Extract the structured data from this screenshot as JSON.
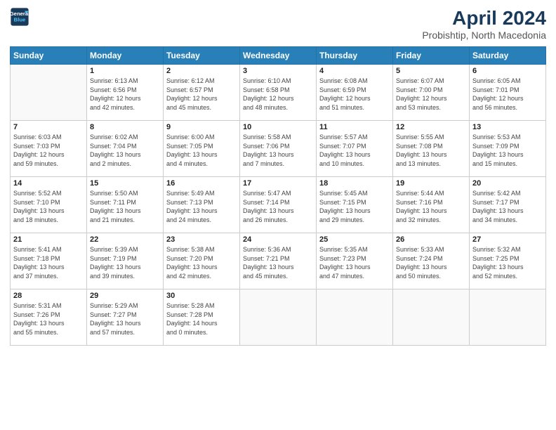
{
  "header": {
    "logo_line1": "General",
    "logo_line2": "Blue",
    "title": "April 2024",
    "subtitle": "Probishtip, North Macedonia"
  },
  "weekdays": [
    "Sunday",
    "Monday",
    "Tuesday",
    "Wednesday",
    "Thursday",
    "Friday",
    "Saturday"
  ],
  "weeks": [
    [
      {
        "day": "",
        "info": ""
      },
      {
        "day": "1",
        "info": "Sunrise: 6:13 AM\nSunset: 6:56 PM\nDaylight: 12 hours\nand 42 minutes."
      },
      {
        "day": "2",
        "info": "Sunrise: 6:12 AM\nSunset: 6:57 PM\nDaylight: 12 hours\nand 45 minutes."
      },
      {
        "day": "3",
        "info": "Sunrise: 6:10 AM\nSunset: 6:58 PM\nDaylight: 12 hours\nand 48 minutes."
      },
      {
        "day": "4",
        "info": "Sunrise: 6:08 AM\nSunset: 6:59 PM\nDaylight: 12 hours\nand 51 minutes."
      },
      {
        "day": "5",
        "info": "Sunrise: 6:07 AM\nSunset: 7:00 PM\nDaylight: 12 hours\nand 53 minutes."
      },
      {
        "day": "6",
        "info": "Sunrise: 6:05 AM\nSunset: 7:01 PM\nDaylight: 12 hours\nand 56 minutes."
      }
    ],
    [
      {
        "day": "7",
        "info": "Sunrise: 6:03 AM\nSunset: 7:03 PM\nDaylight: 12 hours\nand 59 minutes."
      },
      {
        "day": "8",
        "info": "Sunrise: 6:02 AM\nSunset: 7:04 PM\nDaylight: 13 hours\nand 2 minutes."
      },
      {
        "day": "9",
        "info": "Sunrise: 6:00 AM\nSunset: 7:05 PM\nDaylight: 13 hours\nand 4 minutes."
      },
      {
        "day": "10",
        "info": "Sunrise: 5:58 AM\nSunset: 7:06 PM\nDaylight: 13 hours\nand 7 minutes."
      },
      {
        "day": "11",
        "info": "Sunrise: 5:57 AM\nSunset: 7:07 PM\nDaylight: 13 hours\nand 10 minutes."
      },
      {
        "day": "12",
        "info": "Sunrise: 5:55 AM\nSunset: 7:08 PM\nDaylight: 13 hours\nand 13 minutes."
      },
      {
        "day": "13",
        "info": "Sunrise: 5:53 AM\nSunset: 7:09 PM\nDaylight: 13 hours\nand 15 minutes."
      }
    ],
    [
      {
        "day": "14",
        "info": "Sunrise: 5:52 AM\nSunset: 7:10 PM\nDaylight: 13 hours\nand 18 minutes."
      },
      {
        "day": "15",
        "info": "Sunrise: 5:50 AM\nSunset: 7:11 PM\nDaylight: 13 hours\nand 21 minutes."
      },
      {
        "day": "16",
        "info": "Sunrise: 5:49 AM\nSunset: 7:13 PM\nDaylight: 13 hours\nand 24 minutes."
      },
      {
        "day": "17",
        "info": "Sunrise: 5:47 AM\nSunset: 7:14 PM\nDaylight: 13 hours\nand 26 minutes."
      },
      {
        "day": "18",
        "info": "Sunrise: 5:45 AM\nSunset: 7:15 PM\nDaylight: 13 hours\nand 29 minutes."
      },
      {
        "day": "19",
        "info": "Sunrise: 5:44 AM\nSunset: 7:16 PM\nDaylight: 13 hours\nand 32 minutes."
      },
      {
        "day": "20",
        "info": "Sunrise: 5:42 AM\nSunset: 7:17 PM\nDaylight: 13 hours\nand 34 minutes."
      }
    ],
    [
      {
        "day": "21",
        "info": "Sunrise: 5:41 AM\nSunset: 7:18 PM\nDaylight: 13 hours\nand 37 minutes."
      },
      {
        "day": "22",
        "info": "Sunrise: 5:39 AM\nSunset: 7:19 PM\nDaylight: 13 hours\nand 39 minutes."
      },
      {
        "day": "23",
        "info": "Sunrise: 5:38 AM\nSunset: 7:20 PM\nDaylight: 13 hours\nand 42 minutes."
      },
      {
        "day": "24",
        "info": "Sunrise: 5:36 AM\nSunset: 7:21 PM\nDaylight: 13 hours\nand 45 minutes."
      },
      {
        "day": "25",
        "info": "Sunrise: 5:35 AM\nSunset: 7:23 PM\nDaylight: 13 hours\nand 47 minutes."
      },
      {
        "day": "26",
        "info": "Sunrise: 5:33 AM\nSunset: 7:24 PM\nDaylight: 13 hours\nand 50 minutes."
      },
      {
        "day": "27",
        "info": "Sunrise: 5:32 AM\nSunset: 7:25 PM\nDaylight: 13 hours\nand 52 minutes."
      }
    ],
    [
      {
        "day": "28",
        "info": "Sunrise: 5:31 AM\nSunset: 7:26 PM\nDaylight: 13 hours\nand 55 minutes."
      },
      {
        "day": "29",
        "info": "Sunrise: 5:29 AM\nSunset: 7:27 PM\nDaylight: 13 hours\nand 57 minutes."
      },
      {
        "day": "30",
        "info": "Sunrise: 5:28 AM\nSunset: 7:28 PM\nDaylight: 14 hours\nand 0 minutes."
      },
      {
        "day": "",
        "info": ""
      },
      {
        "day": "",
        "info": ""
      },
      {
        "day": "",
        "info": ""
      },
      {
        "day": "",
        "info": ""
      }
    ]
  ]
}
